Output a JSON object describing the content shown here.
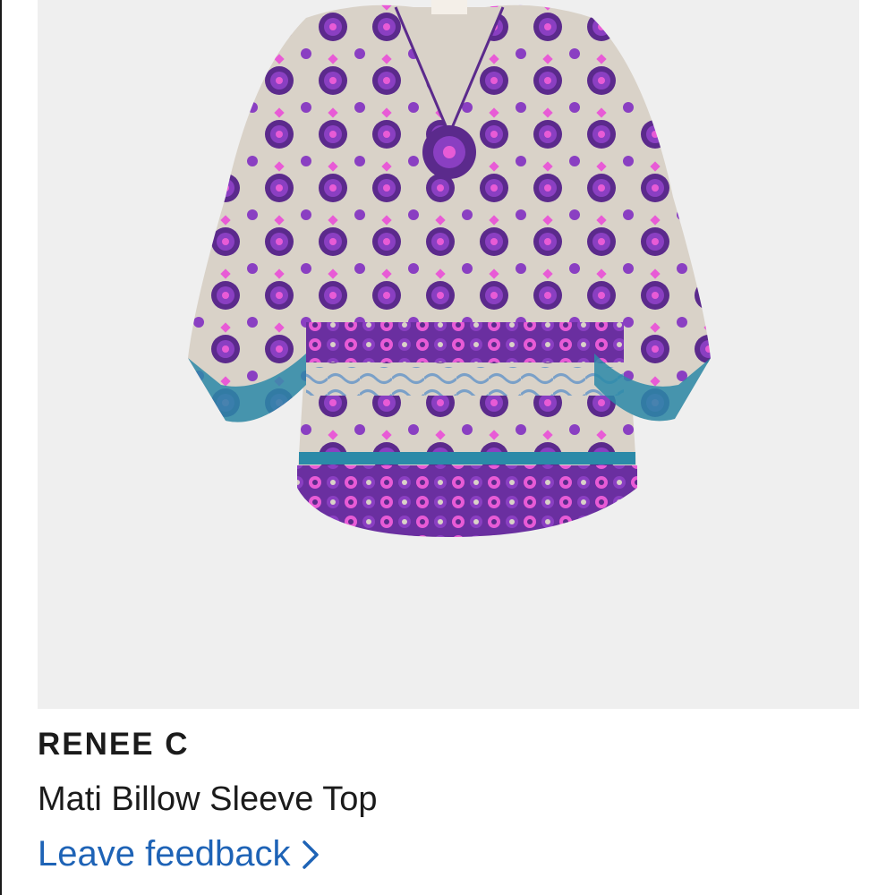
{
  "product": {
    "brand": "RENEE C",
    "name": "Mati Billow Sleeve Top",
    "feedback_label": "Leave feedback",
    "image_icon": "patterned-blouse-image"
  },
  "colors": {
    "image_background": "#efefef",
    "brand_text": "#1b1b1b",
    "link": "#1e63b6",
    "fabric_base": "#d9d2c8",
    "pattern_purple": "#5b2a8c",
    "pattern_violet": "#8a3fc2",
    "pattern_pink": "#e85bd6",
    "pattern_teal": "#2b8aa8"
  }
}
